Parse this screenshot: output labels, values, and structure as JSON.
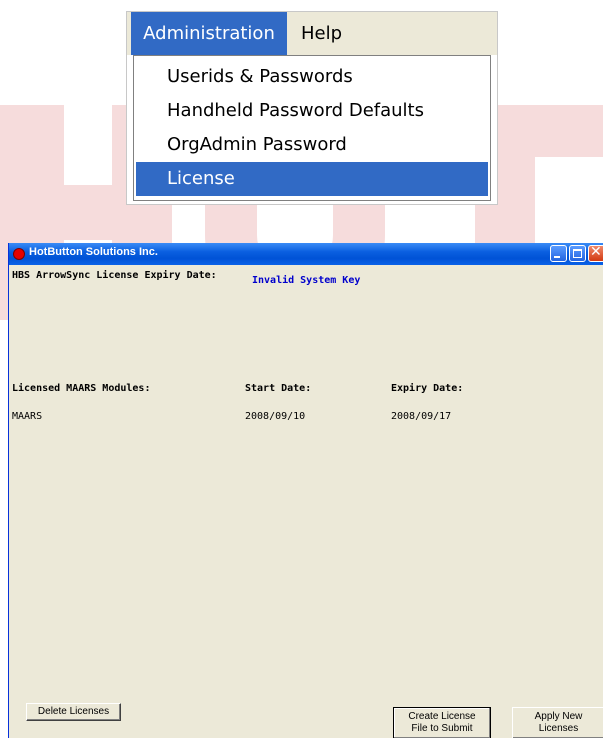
{
  "menu": {
    "bar": [
      "Administration",
      "Help"
    ],
    "items": [
      "Userids & Passwords",
      "Handheld Password Defaults",
      "OrgAdmin Password",
      "License"
    ],
    "selected": "License"
  },
  "window": {
    "title": "HotButton Solutions Inc.",
    "expiry_label": "HBS ArrowSync License Expiry Date:",
    "expiry_value": "Invalid System Key",
    "modules_header": "Licensed MAARS Modules:",
    "start_header": "Start Date:",
    "expiry_header": "Expiry Date:",
    "rows": [
      {
        "module": "MAARS",
        "start": "2008/09/10",
        "expiry": "2008/09/17"
      }
    ],
    "buttons": {
      "delete": "Delete Licenses",
      "create_line1": "Create License",
      "create_line2": "File to Submit",
      "apply_line1": "Apply New",
      "apply_line2": "Licenses"
    }
  },
  "colors": {
    "titlebar": "#0a5fe0",
    "menu_highlight": "#316ac5",
    "window_bg": "#ece9d8",
    "status_value": "#0000cc",
    "watermark": "#f6dcdc"
  }
}
